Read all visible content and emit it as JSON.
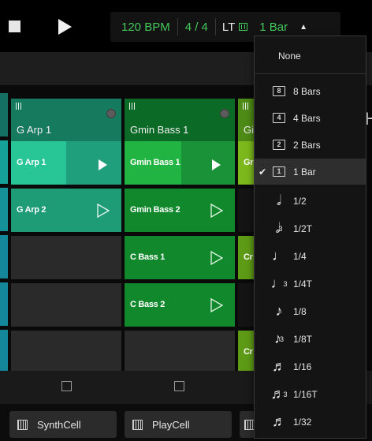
{
  "transport": {
    "bpm": "120 BPM",
    "time_signature": "4 / 4",
    "launch_label": "LT",
    "quantize_value": "1 Bar",
    "caret": "▲"
  },
  "columns": [
    {
      "title": "G Arp 1",
      "color": "#1a7a5a",
      "cells": [
        {
          "name": "G Arp 1",
          "state": "playing",
          "color": "#22b386"
        },
        {
          "name": "G Arp 2",
          "state": "stopped",
          "color": "#1e9e74"
        },
        {
          "name": "",
          "state": "empty"
        },
        {
          "name": "",
          "state": "empty"
        },
        {
          "name": "",
          "state": "empty"
        }
      ]
    },
    {
      "title": "Gmin Bass 1",
      "color": "#0d6e28",
      "cells": [
        {
          "name": "Gmin Bass 1",
          "state": "playing",
          "color": "#1ea83a"
        },
        {
          "name": "Gmin Bass 2",
          "state": "stopped",
          "color": "#12862c"
        },
        {
          "name": "C Bass 1",
          "state": "stopped",
          "color": "#12862c"
        },
        {
          "name": "C Bass 2",
          "state": "stopped",
          "color": "#12862c"
        },
        {
          "name": "",
          "state": "empty"
        }
      ]
    }
  ],
  "peek_column": {
    "title": "Gi",
    "cells": [
      "Gr",
      "",
      "Cr",
      "",
      "Cr"
    ],
    "header_color": "#4e8a16",
    "cell_color": "#6eaa18"
  },
  "peek_heading": "H",
  "devices": [
    {
      "label": "SynthCell"
    },
    {
      "label": "PlayCell"
    }
  ],
  "quantize_menu": {
    "none_label": "None",
    "items": [
      {
        "icon": "8-bars-icon",
        "glyph": "8",
        "label": "8 Bars",
        "selected": false
      },
      {
        "icon": "4-bars-icon",
        "glyph": "4",
        "label": "4 Bars",
        "selected": false
      },
      {
        "icon": "2-bars-icon",
        "glyph": "2",
        "label": "2 Bars",
        "selected": false
      },
      {
        "icon": "1-bar-icon",
        "glyph": "1",
        "label": "1 Bar",
        "selected": true
      },
      {
        "icon": "half-note-icon",
        "glyph": "𝅗𝅥",
        "label": "1/2",
        "selected": false
      },
      {
        "icon": "half-note-triplet-icon",
        "glyph": "𝅗𝅥",
        "trip": "3",
        "label": "1/2T",
        "selected": false
      },
      {
        "icon": "quarter-note-icon",
        "glyph": "♩",
        "label": "1/4",
        "selected": false
      },
      {
        "icon": "quarter-note-triplet-icon",
        "glyph": "♩",
        "trip": "3",
        "label": "1/4T",
        "selected": false
      },
      {
        "icon": "eighth-note-icon",
        "glyph": "♪",
        "label": "1/8",
        "selected": false
      },
      {
        "icon": "eighth-note-triplet-icon",
        "glyph": "♪",
        "trip": "3",
        "label": "1/8T",
        "selected": false
      },
      {
        "icon": "sixteenth-note-icon",
        "glyph": "♬",
        "label": "1/16",
        "selected": false
      },
      {
        "icon": "sixteenth-note-triplet-icon",
        "glyph": "♬",
        "trip": "3",
        "label": "1/16T",
        "selected": false
      },
      {
        "icon": "thirty-second-note-icon",
        "glyph": "♬",
        "label": "1/32",
        "selected": false
      }
    ]
  }
}
